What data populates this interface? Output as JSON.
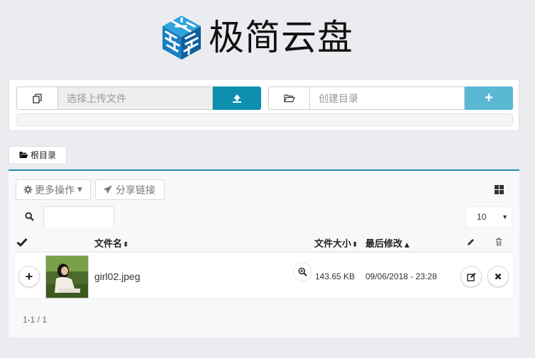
{
  "app": {
    "title": "极简云盘"
  },
  "upload": {
    "file_placeholder": "选择上传文件",
    "dir_placeholder": "创建目录",
    "add_label": "+"
  },
  "breadcrumb": {
    "root_label": "根目录"
  },
  "toolbar": {
    "more_actions_label": "更多操作",
    "share_link_label": "分享链接",
    "page_size_value": "10"
  },
  "table": {
    "headers": {
      "name": "文件名",
      "size": "文件大小",
      "modified": "最后修改"
    },
    "rows": [
      {
        "thumbnail_icon": "image-thumbnail",
        "name": "girl02.jpeg",
        "size": "143.65 KB",
        "modified": "09/06/2018 - 23:28"
      }
    ]
  },
  "pagination": {
    "summary": "1-1 / 1"
  },
  "colors": {
    "accent": "#0f8fb0",
    "accent_light": "#5bb8d3",
    "logo_blue": "#1783c6",
    "background": "#eaecf0"
  }
}
